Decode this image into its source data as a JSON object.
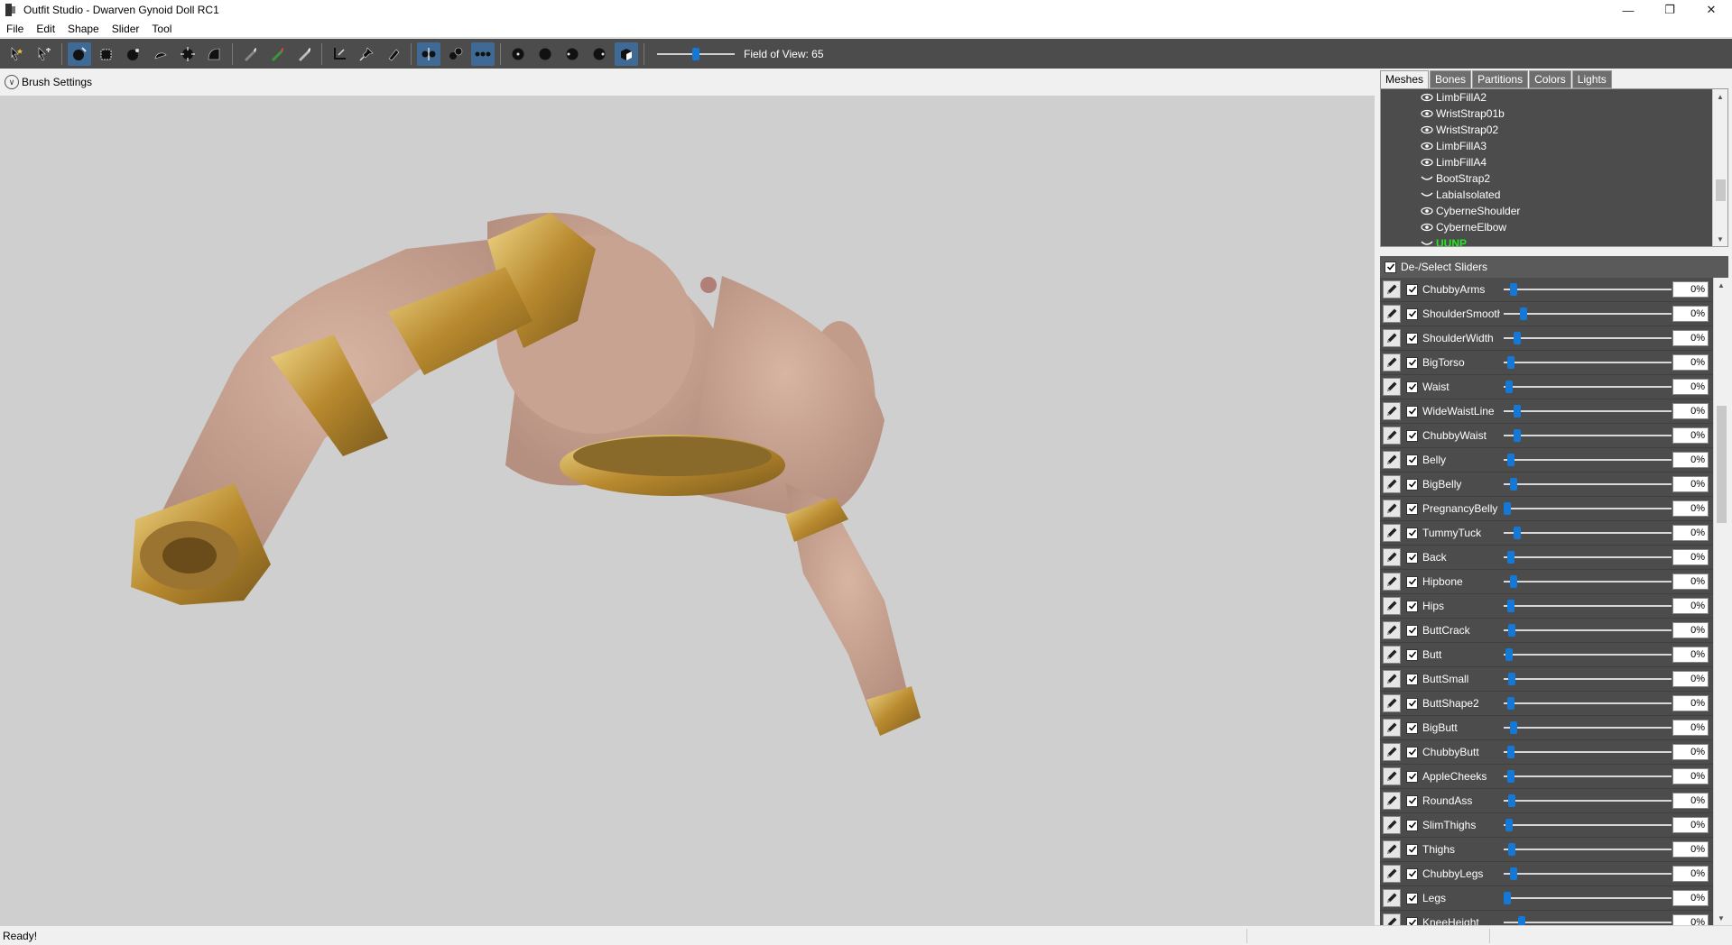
{
  "window": {
    "title": "Outfit Studio - Dwarven Gynoid Doll RC1",
    "controls": {
      "minimize": "—",
      "restore": "❐",
      "close": "✕"
    }
  },
  "menu": [
    "File",
    "Edit",
    "Shape",
    "Slider",
    "Tool"
  ],
  "toolbar": {
    "fov_label": "Field of View: 65",
    "fov_value": 65,
    "icons": [
      "select-icon",
      "transform-icon",
      "mask-brush-icon",
      "inflate-brush-icon",
      "deflate-brush-icon",
      "move-brush-icon",
      "smooth-brush-icon",
      "undiff-brush-icon",
      "weight-brush-icon",
      "color-brush-icon",
      "alpha-brush-icon",
      "collision-icon",
      "pin-icon",
      "eraser-icon",
      "mirror-x-icon",
      "mirror-y-icon",
      "mirror-z-icon",
      "view-front-icon",
      "view-back-icon",
      "view-left-icon",
      "view-right-icon",
      "perspective-icon"
    ]
  },
  "brush_settings": {
    "label": "Brush Settings"
  },
  "panel": {
    "tabs": [
      "Meshes",
      "Bones",
      "Partitions",
      "Colors",
      "Lights"
    ],
    "active_tab": "Meshes",
    "meshes": [
      {
        "name": "LimbFillA2",
        "visible": true
      },
      {
        "name": "WristStrap01b",
        "visible": true
      },
      {
        "name": "WristStrap02",
        "visible": true
      },
      {
        "name": "LimbFillA3",
        "visible": true
      },
      {
        "name": "LimbFillA4",
        "visible": true
      },
      {
        "name": "BootStrap2",
        "visible": false
      },
      {
        "name": "LabiaIsolated",
        "visible": false
      },
      {
        "name": "CyberneShoulder",
        "visible": true
      },
      {
        "name": "CyberneElbow",
        "visible": true
      },
      {
        "name": "UUNP",
        "visible": false,
        "highlight": true
      }
    ],
    "slider_header": "De-/Select Sliders",
    "sliders": [
      {
        "name": "ChubbyArms",
        "pos": 0.04,
        "value": "0%"
      },
      {
        "name": "ShoulderSmooth",
        "pos": 0.1,
        "value": "0%"
      },
      {
        "name": "ShoulderWidth",
        "pos": 0.06,
        "value": "0%"
      },
      {
        "name": "BigTorso",
        "pos": 0.02,
        "value": "0%"
      },
      {
        "name": "Waist",
        "pos": 0.01,
        "value": "0%"
      },
      {
        "name": "WideWaistLine",
        "pos": 0.06,
        "value": "0%"
      },
      {
        "name": "ChubbyWaist",
        "pos": 0.06,
        "value": "0%"
      },
      {
        "name": "Belly",
        "pos": 0.02,
        "value": "0%"
      },
      {
        "name": "BigBelly",
        "pos": 0.04,
        "value": "0%"
      },
      {
        "name": "PregnancyBelly",
        "pos": 0.0,
        "value": "0%"
      },
      {
        "name": "TummyTuck",
        "pos": 0.06,
        "value": "0%"
      },
      {
        "name": "Back",
        "pos": 0.02,
        "value": "0%"
      },
      {
        "name": "Hipbone",
        "pos": 0.04,
        "value": "0%"
      },
      {
        "name": "Hips",
        "pos": 0.02,
        "value": "0%"
      },
      {
        "name": "ButtCrack",
        "pos": 0.03,
        "value": "0%"
      },
      {
        "name": "Butt",
        "pos": 0.01,
        "value": "0%"
      },
      {
        "name": "ButtSmall",
        "pos": 0.03,
        "value": "0%"
      },
      {
        "name": "ButtShape2",
        "pos": 0.02,
        "value": "0%"
      },
      {
        "name": "BigButt",
        "pos": 0.04,
        "value": "0%"
      },
      {
        "name": "ChubbyButt",
        "pos": 0.02,
        "value": "0%"
      },
      {
        "name": "AppleCheeks",
        "pos": 0.02,
        "value": "0%"
      },
      {
        "name": "RoundAss",
        "pos": 0.03,
        "value": "0%"
      },
      {
        "name": "SlimThighs",
        "pos": 0.01,
        "value": "0%"
      },
      {
        "name": "Thighs",
        "pos": 0.03,
        "value": "0%"
      },
      {
        "name": "ChubbyLegs",
        "pos": 0.04,
        "value": "0%"
      },
      {
        "name": "Legs",
        "pos": 0.0,
        "value": "0%"
      },
      {
        "name": "KneeHeight",
        "pos": 0.09,
        "value": "0%"
      }
    ]
  },
  "status": {
    "text": "Ready!"
  },
  "colors": {
    "toolbar_bg": "#4c4c4c",
    "viewport_bg": "#cfcfcf",
    "accent": "#1478d6",
    "skin": "#c9a392",
    "gold": "#c9a24b",
    "highlight_mesh": "#26e626"
  }
}
